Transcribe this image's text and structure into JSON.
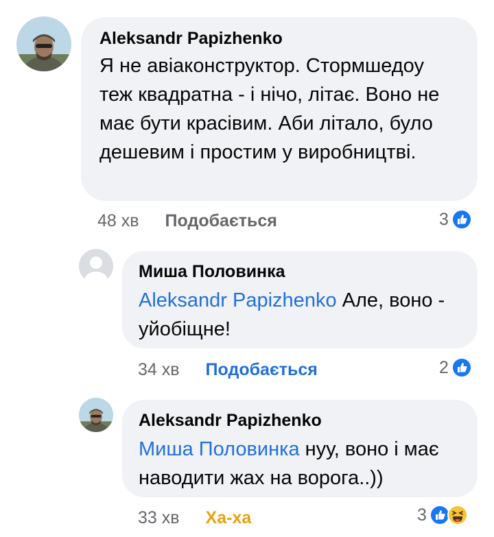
{
  "comments": [
    {
      "author": "Aleksandr Papizhenko",
      "mention": "",
      "text": "Я не авіаконструктор. Стормшедоу теж квадратна - і нічо, літає. Воно не має бути красівим. Аби літало, було дешевим і простим у виробництві.",
      "time": "48 хв",
      "action": "Подобається",
      "reaction_count": "3",
      "reactions": [
        "like-icon"
      ]
    },
    {
      "author": "Миша Половинка",
      "mention": "Aleksandr Papizhenko",
      "text": "Але, воно - уйобіщне!",
      "time": "34 хв",
      "action": "Подобається",
      "reaction_count": "2",
      "reactions": [
        "like-icon"
      ]
    },
    {
      "author": "Aleksandr Papizhenko",
      "mention": "Миша Половинка",
      "text": "нуу, воно і має наводити жах на ворога..))",
      "time": "33 хв",
      "action": "Ха-ха",
      "reaction_count": "3",
      "reactions": [
        "like-icon",
        "haha-icon"
      ]
    }
  ],
  "colors": {
    "like_active": "#216fdb",
    "haha_active": "#e8a311",
    "bubble": "#f0f2f5",
    "muted": "#65676b",
    "like_icon": "#1877f2"
  }
}
